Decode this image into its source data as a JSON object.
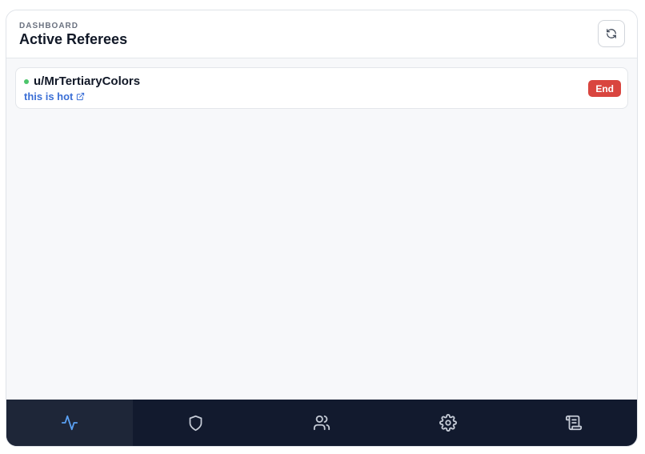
{
  "header": {
    "eyebrow": "DASHBOARD",
    "title": "Active Referees",
    "refresh_icon": "refresh-icon"
  },
  "referees": [
    {
      "username": "u/MrTertiaryColors",
      "status": "active",
      "status_color": "#4cc56b",
      "link_text": "this is hot",
      "link_icon": "external-link-icon",
      "action_label": "End"
    }
  ],
  "nav": {
    "active_index": 0,
    "items": [
      {
        "icon": "activity-icon"
      },
      {
        "icon": "shield-icon"
      },
      {
        "icon": "users-icon"
      },
      {
        "icon": "gear-icon"
      },
      {
        "icon": "scroll-icon"
      }
    ]
  },
  "colors": {
    "accent": "#5aa0f2",
    "nav_background": "#121a2e",
    "danger": "#d9453f",
    "link": "#3b6fd6"
  }
}
